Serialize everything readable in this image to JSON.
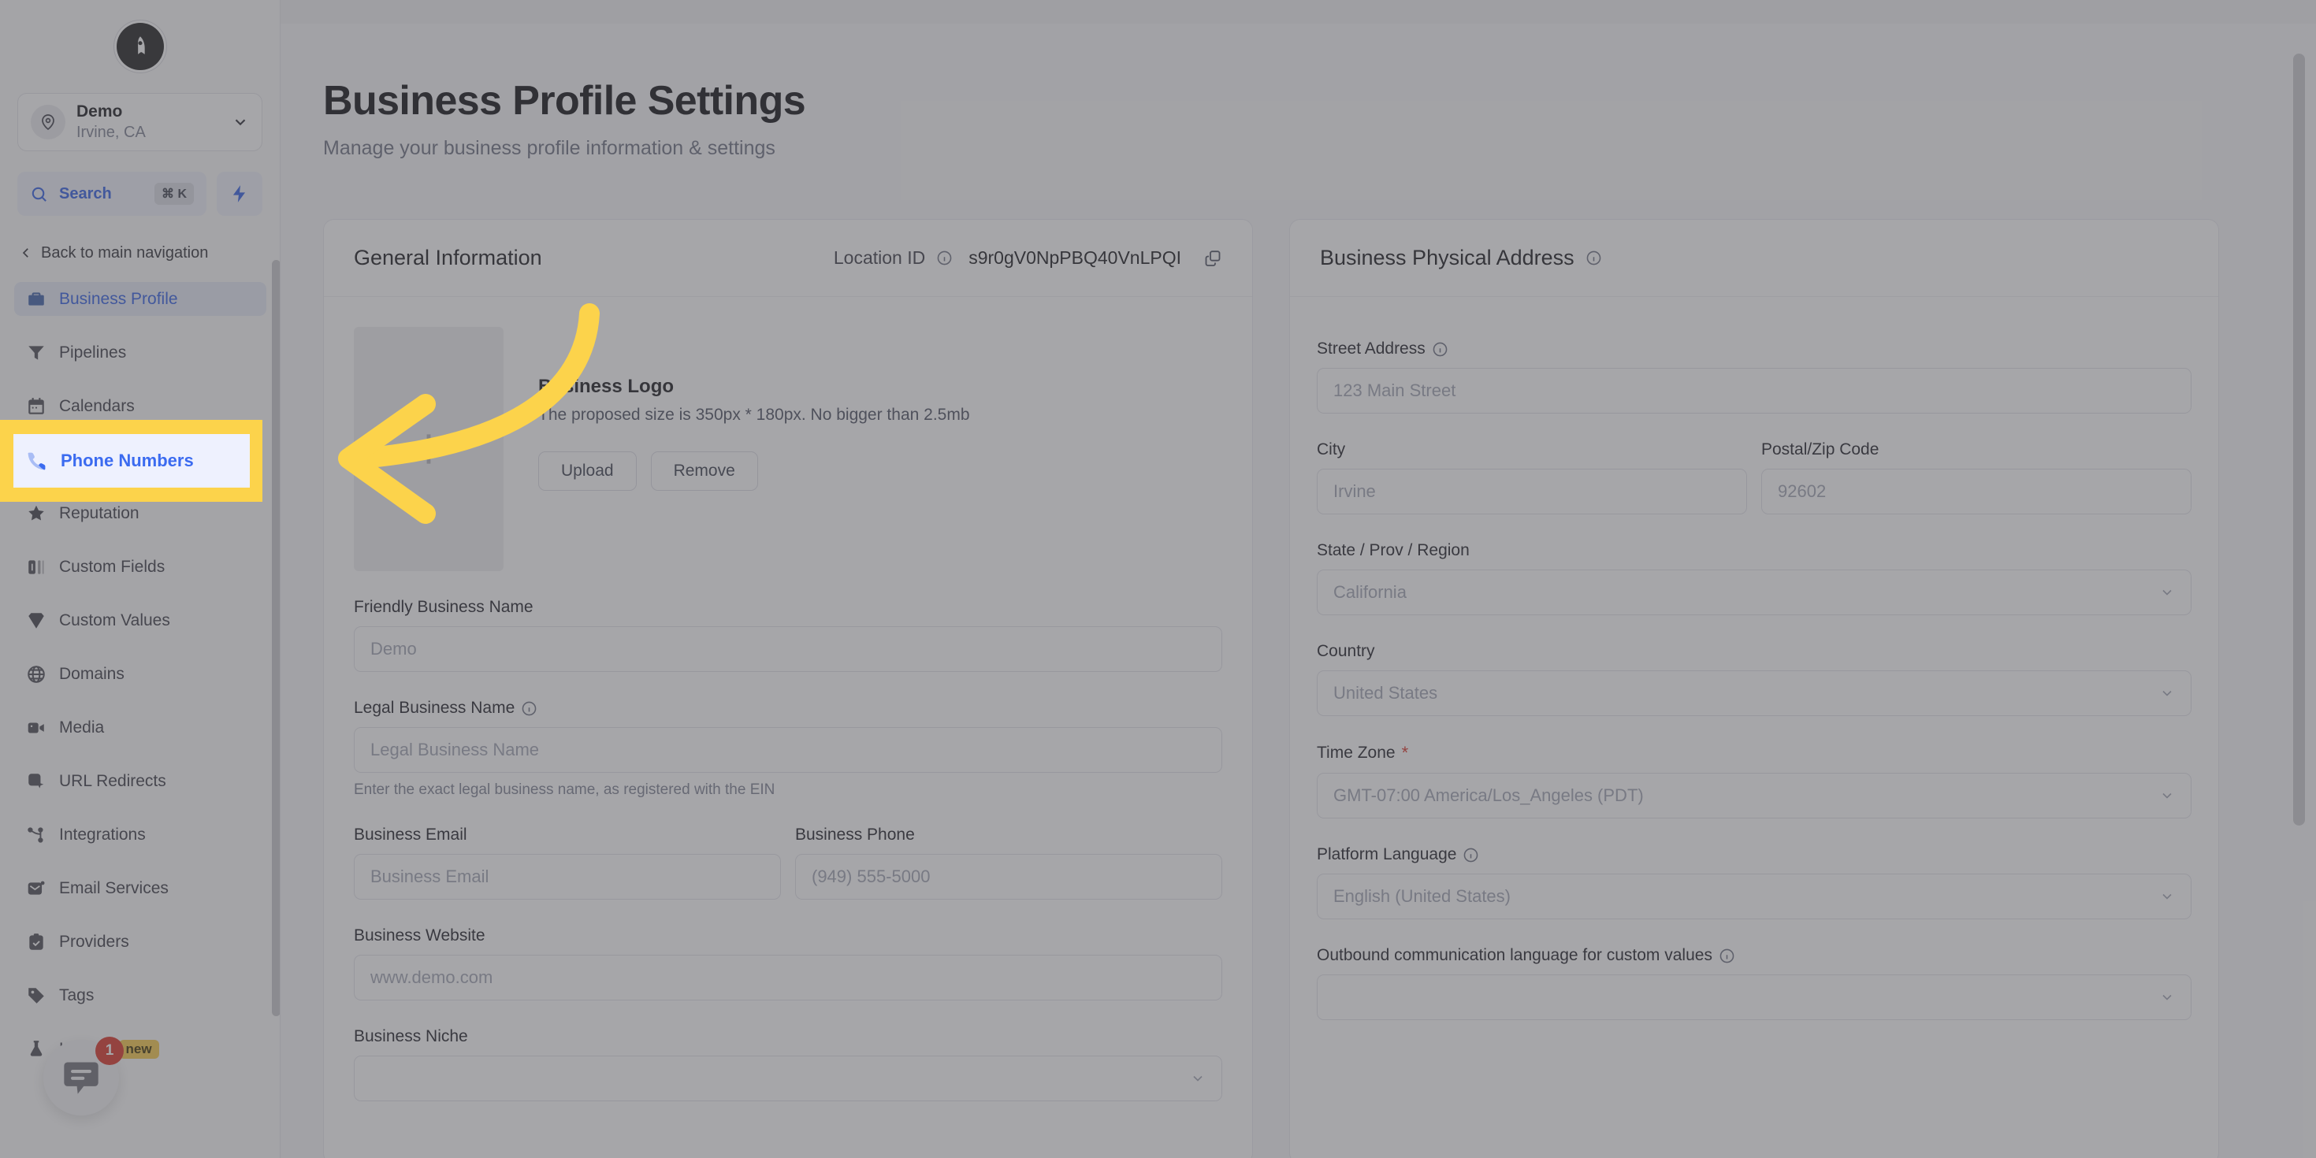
{
  "sidebar": {
    "brand_icon": "rocket-logo-icon",
    "location": {
      "name": "Demo",
      "sub": "Irvine, CA",
      "avatar_icon": "map-pin-icon",
      "chevron_icon": "chevron-down-icon"
    },
    "search": {
      "label": "Search",
      "shortcut": "⌘ K",
      "icon": "search-icon"
    },
    "quick_action_icon": "lightning-bolt-icon",
    "back_nav": {
      "label": "Back to main navigation",
      "icon": "chevron-left-icon"
    },
    "items": [
      {
        "label": "Business Profile",
        "icon": "briefcase-icon",
        "state": "active"
      },
      {
        "label": "Pipelines",
        "icon": "funnel-icon",
        "state": "default"
      },
      {
        "label": "Calendars",
        "icon": "calendar-icon",
        "state": "default"
      },
      {
        "label": "Phone Numbers",
        "icon": "phone-icon",
        "state": "highlighted"
      },
      {
        "label": "Reputation",
        "icon": "star-icon",
        "state": "default"
      },
      {
        "label": "Custom Fields",
        "icon": "form-field-icon",
        "state": "default"
      },
      {
        "label": "Custom Values",
        "icon": "gem-icon",
        "state": "default"
      },
      {
        "label": "Domains",
        "icon": "globe-icon",
        "state": "default"
      },
      {
        "label": "Media",
        "icon": "video-camera-icon",
        "state": "default"
      },
      {
        "label": "URL Redirects",
        "icon": "cursor-click-icon",
        "state": "default"
      },
      {
        "label": "Integrations",
        "icon": "nodes-icon",
        "state": "default"
      },
      {
        "label": "Email Services",
        "icon": "envelope-icon",
        "state": "default"
      },
      {
        "label": "Providers",
        "icon": "clipboard-check-icon",
        "state": "default"
      },
      {
        "label": "Tags",
        "icon": "tag-icon",
        "state": "default"
      },
      {
        "label": "Labs",
        "icon": "flask-icon",
        "state": "default",
        "badge": "new"
      }
    ],
    "chat_widget": {
      "icon": "chat-bubble-icon",
      "unread_count": "1"
    }
  },
  "page": {
    "title": "Business Profile Settings",
    "subtitle": "Manage your business profile information & settings"
  },
  "general_card": {
    "title": "General Information",
    "location_id_label": "Location ID",
    "location_id_info_icon": "info-icon",
    "location_id_value": "s9r0gV0NpPBQ40VnLPQI",
    "copy_icon": "copy-icon",
    "logo": {
      "placeholder_icon": "plus-icon",
      "title": "Business Logo",
      "description": "The proposed size is 350px * 180px. No bigger than 2.5mb",
      "upload_label": "Upload",
      "remove_label": "Remove"
    },
    "fields": {
      "friendly_name_label": "Friendly Business Name",
      "friendly_name_placeholder": "Demo",
      "legal_name_label": "Legal Business Name",
      "legal_name_info_icon": "info-icon",
      "legal_name_placeholder": "Legal Business Name",
      "legal_name_help": "Enter the exact legal business name, as registered with the EIN",
      "email_label": "Business Email",
      "email_placeholder": "Business Email",
      "phone_label": "Business Phone",
      "phone_placeholder": "(949) 555-5000",
      "website_label": "Business Website",
      "website_placeholder": "www.demo.com",
      "niche_label": "Business Niche",
      "niche_value": "",
      "niche_chevron_icon": "chevron-down-icon"
    }
  },
  "address_card": {
    "title": "Business Physical Address",
    "title_info_icon": "info-icon",
    "fields": {
      "street_label": "Street Address",
      "street_info_icon": "info-icon",
      "street_placeholder": "123 Main Street",
      "city_label": "City",
      "city_placeholder": "Irvine",
      "postal_label": "Postal/Zip Code",
      "postal_placeholder": "92602",
      "state_label": "State / Prov / Region",
      "state_value": "California",
      "country_label": "Country",
      "country_value": "United States",
      "timezone_label": "Time Zone",
      "timezone_required": "*",
      "timezone_value": "GMT-07:00 America/Los_Angeles (PDT)",
      "platform_language_label": "Platform Language",
      "platform_language_info_icon": "info-icon",
      "platform_language_value": "English (United States)",
      "outbound_language_label": "Outbound communication language for custom values",
      "outbound_language_info_icon": "info-icon",
      "outbound_language_value": "",
      "chevron_icon": "chevron-down-icon"
    }
  },
  "annotation": {
    "type": "curved-arrow",
    "color": "#fcd34b",
    "points_to": "Phone Numbers",
    "highlight_color": "#fcd34b",
    "dim_color": "rgba(85,85,90,0.52)"
  }
}
